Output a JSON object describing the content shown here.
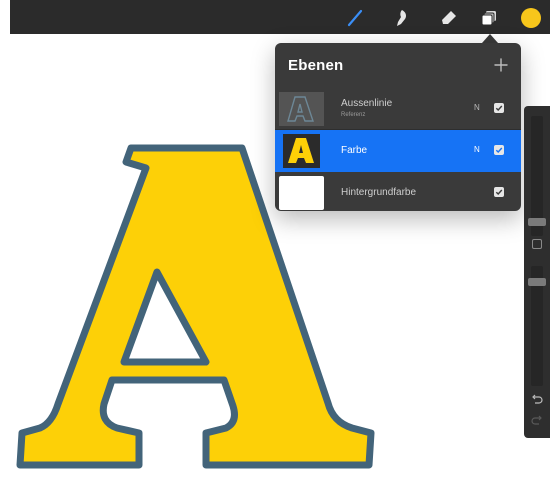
{
  "toolbar": {
    "tools": [
      {
        "id": "brush",
        "icon": "brush-icon",
        "active": true,
        "color": "#3a8ef6"
      },
      {
        "id": "smudge",
        "icon": "smudge-icon",
        "active": false
      },
      {
        "id": "eraser",
        "icon": "eraser-icon",
        "active": false
      },
      {
        "id": "layers",
        "icon": "layers-icon",
        "active": true
      }
    ],
    "current_color": "#f7c61b"
  },
  "layers_panel": {
    "title": "Ebenen",
    "add_icon": "plus-icon",
    "layers": [
      {
        "name": "Aussenlinie",
        "subtitle": "Referenz",
        "blend": "N",
        "visible": true,
        "selected": false,
        "thumbnail": "outline-letter-a"
      },
      {
        "name": "Farbe",
        "subtitle": "",
        "blend": "N",
        "visible": true,
        "selected": true,
        "thumbnail": "yellow-letter-a"
      },
      {
        "name": "Hintergrundfarbe",
        "subtitle": "",
        "blend": "",
        "visible": true,
        "selected": false,
        "thumbnail": "white-fill"
      }
    ]
  },
  "sidebar": {
    "icons": [
      "modify-icon",
      "undo-icon",
      "redo-icon"
    ]
  },
  "colors": {
    "accent": "#1673f5",
    "letter_fill": "#fdd007",
    "letter_stroke": "#43647a",
    "panel_bg": "#3a3a3a",
    "toolbar_bg": "#2b2b2b"
  }
}
